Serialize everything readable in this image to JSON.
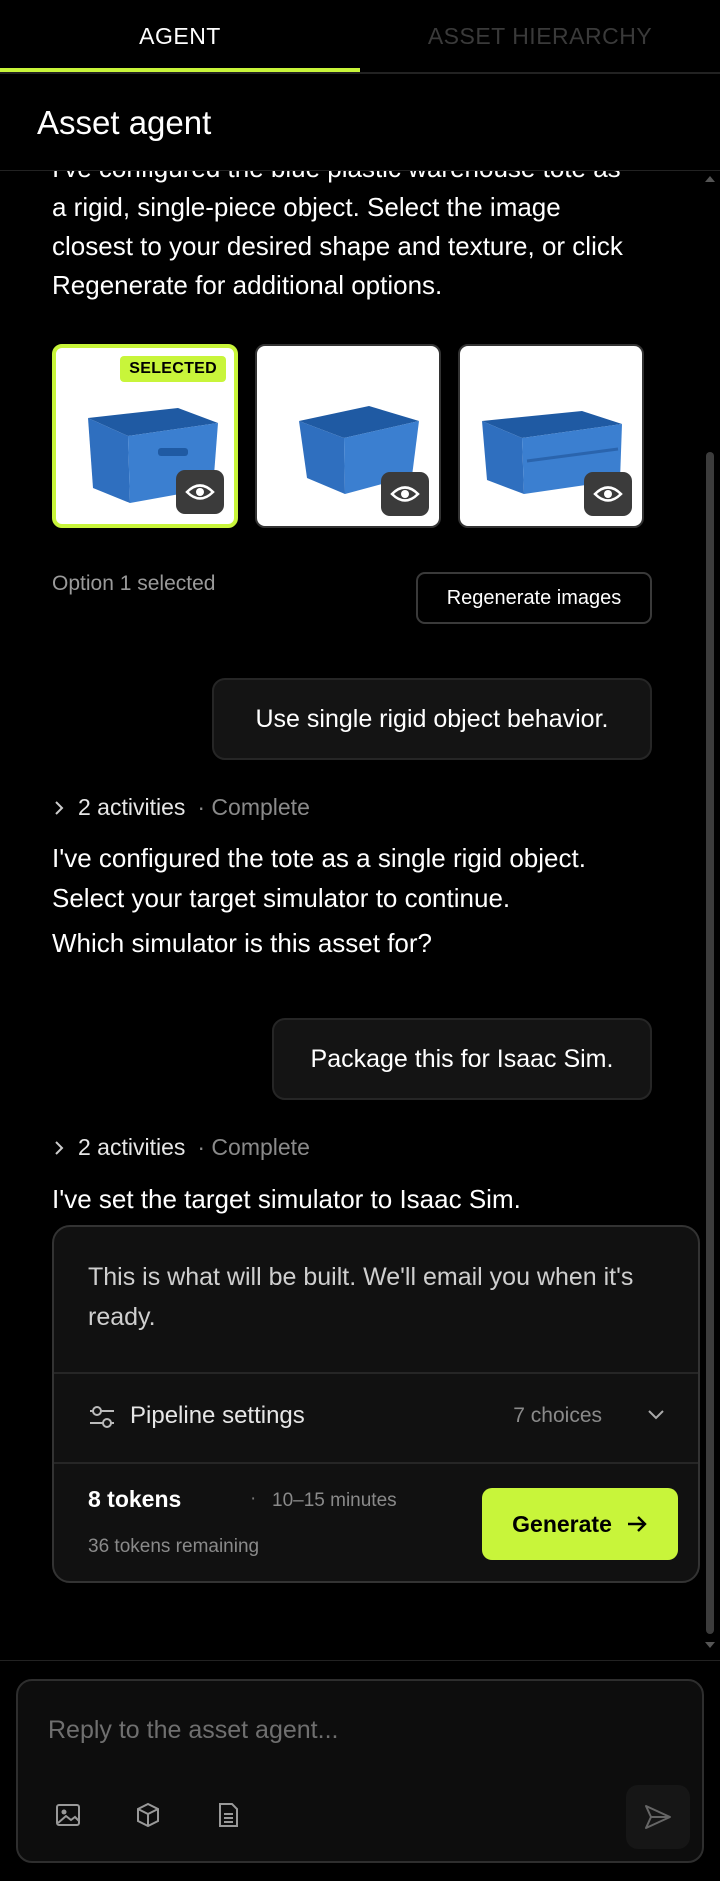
{
  "tabs": {
    "agent": "AGENT",
    "hierarchy": "ASSET HIERARCHY"
  },
  "header": {
    "title": "Asset agent"
  },
  "messages": {
    "agent1_cut": "I've configured the blue plastic warehouse tote as",
    "agent1_l2": "a rigid, single-piece object. Select the image",
    "agent1_l3": "closest to your desired shape and texture, or click",
    "agent1_l4": "Regenerate for additional options.",
    "selected_badge": "SELECTED",
    "option_status": "Option 1 selected",
    "regenerate_label": "Regenerate images",
    "user1": "Use single rigid object behavior.",
    "activities1_count": "2 activities",
    "activities1_status": "· Complete",
    "agent2_l1": "I've configured the tote as a single rigid object.",
    "agent2_l2": "Select your target simulator to continue.",
    "agent2_q": "Which simulator is this asset for?",
    "user2": "Package this for Isaac Sim.",
    "activities2_count": "2 activities",
    "activities2_status": "· Complete",
    "agent3": "I've set the target simulator to Isaac Sim."
  },
  "build_card": {
    "intro": "This is what will be built. We'll email you when it's ready.",
    "pipeline_label": "Pipeline settings",
    "choices": "7 choices",
    "tokens": "8 tokens",
    "separator": "·",
    "duration": "10–15 minutes",
    "remaining": "36 tokens remaining",
    "generate_label": "Generate"
  },
  "composer": {
    "placeholder": "Reply to the asset agent..."
  },
  "colors": {
    "accent": "#c8f53a",
    "tote_blue": "#2f6fbf"
  },
  "icons": [
    "chevron-right-icon",
    "eye-icon",
    "sliders-icon",
    "chevron-down-icon",
    "arrow-right-icon",
    "image-icon",
    "cube-icon",
    "document-icon",
    "send-icon"
  ]
}
